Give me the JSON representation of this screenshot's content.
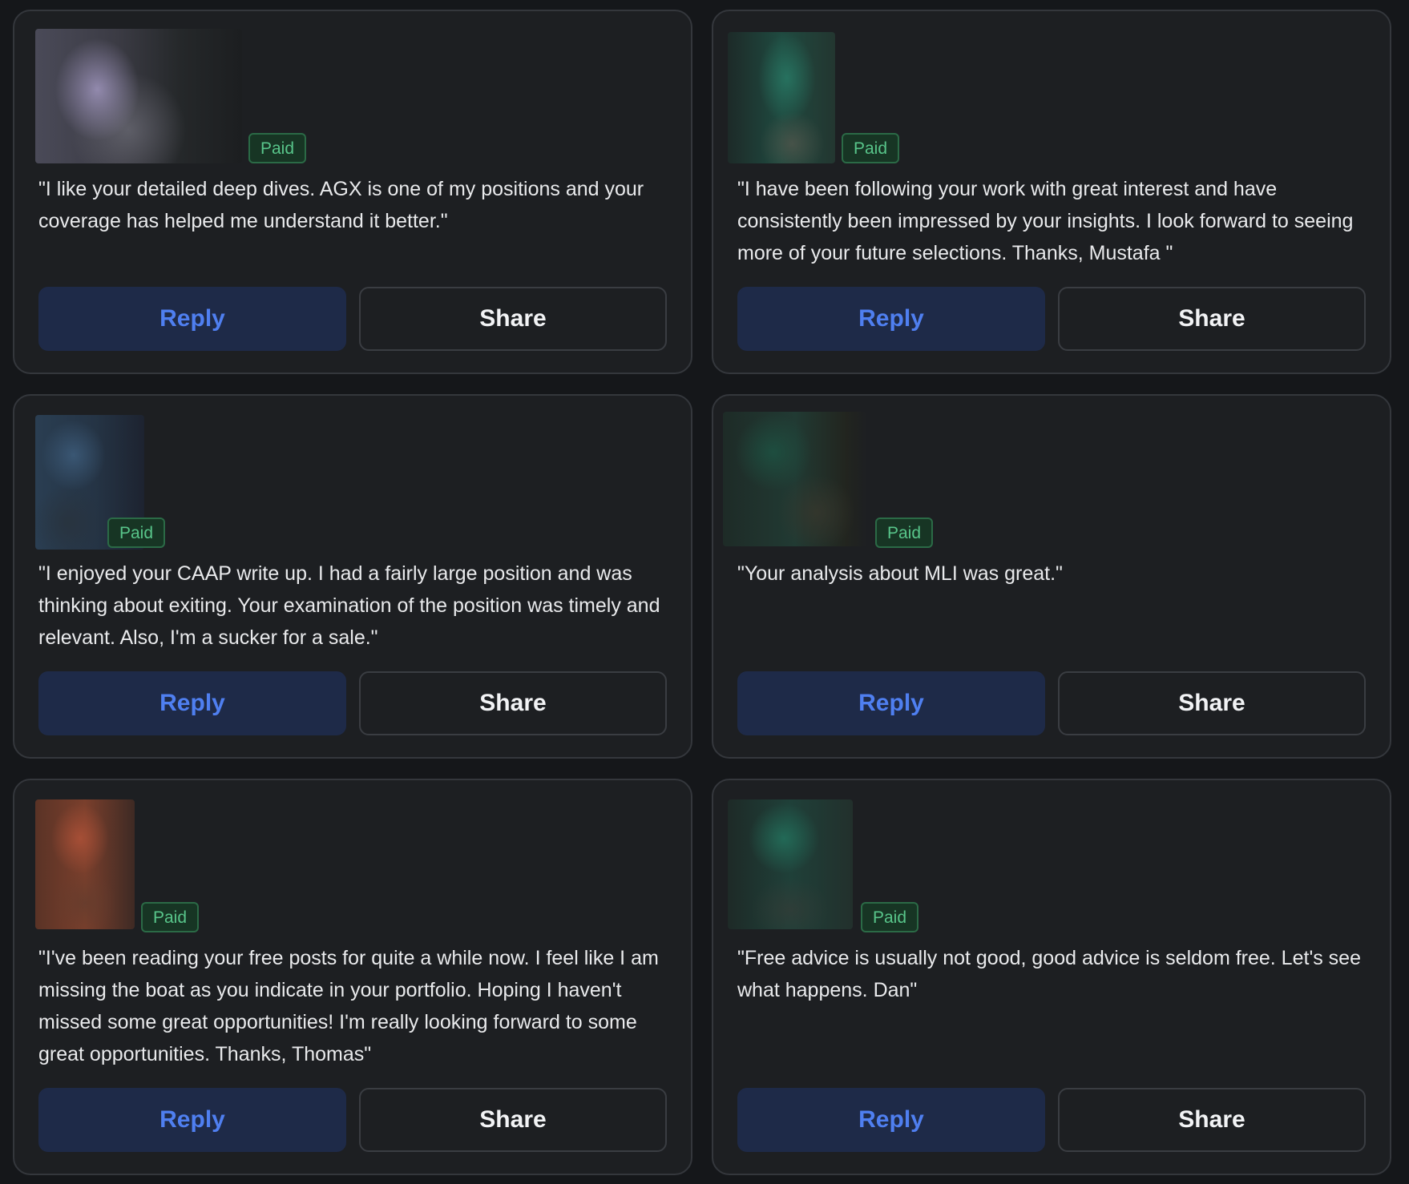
{
  "cards": [
    {
      "badge": "Paid",
      "quote": "\"I like your detailed deep dives. AGX is one of my positions and your coverage has helped me understand it better.\"",
      "reply_label": "Reply",
      "share_label": "Share"
    },
    {
      "badge": "Paid",
      "quote": "\"I have been following your work with great interest and have consistently been impressed by your insights. I look forward to seeing more of your future selections. Thanks, Mustafa \"",
      "reply_label": "Reply",
      "share_label": "Share"
    },
    {
      "badge": "Paid",
      "quote": "\"I enjoyed your CAAP write up. I had a fairly large position and was thinking about exiting. Your examination of the position was timely and relevant. Also, I'm a sucker for a sale.\"",
      "reply_label": "Reply",
      "share_label": "Share"
    },
    {
      "badge": "Paid",
      "quote": "\"Your analysis about MLI was great.\"",
      "reply_label": "Reply",
      "share_label": "Share"
    },
    {
      "badge": "Paid",
      "quote": "\"I've been reading your free posts for quite a while now. I feel like I am missing the boat as you indicate in your portfolio. Hoping I haven't missed some great opportunities! I'm really looking forward to some great opportunities. Thanks, Thomas\"",
      "reply_label": "Reply",
      "share_label": "Share"
    },
    {
      "badge": "Paid",
      "quote": "\"Free advice is usually not good, good advice is seldom free. Let's see what happens. Dan\"",
      "reply_label": "Reply",
      "share_label": "Share"
    }
  ],
  "colors": {
    "background": "#15171a",
    "card": "#1d1f22",
    "paid_text": "#58c58a",
    "paid_bg": "#173524",
    "reply_text": "#4f7ff0",
    "reply_bg": "#1e2a48",
    "text": "#e9eaec"
  }
}
